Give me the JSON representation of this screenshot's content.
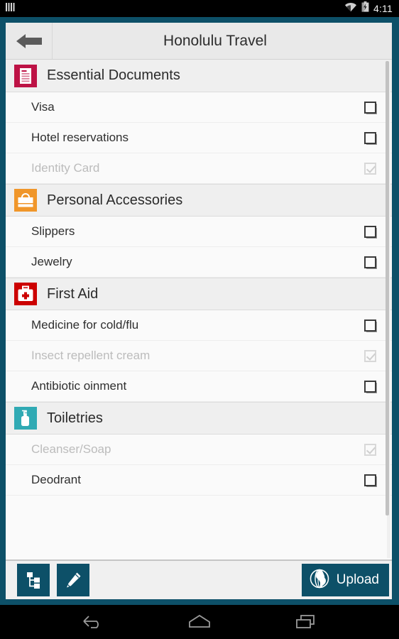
{
  "statusbar": {
    "time": "4:11",
    "icons": [
      "menu-bars-icon",
      "wifi-icon",
      "battery-icon"
    ]
  },
  "titlebar": {
    "back_label": "back-arrow-icon",
    "title": "Honolulu Travel"
  },
  "colors": {
    "frame_teal": "#0d5068",
    "documents_crimson": "#bd1245",
    "accessories_orange": "#f0962a",
    "firstaid_red": "#cc0000",
    "toiletries_teal": "#30aab4",
    "list_bg": "#fafafa",
    "header_bg": "#efefef"
  },
  "checklist": {
    "categories": [
      {
        "label": "Essential Documents",
        "icon": "document-icon",
        "icon_color": "#bd1245",
        "items": [
          {
            "label": "Visa",
            "checked": false
          },
          {
            "label": "Hotel reservations",
            "checked": false
          },
          {
            "label": "Identity Card",
            "checked": true
          }
        ]
      },
      {
        "label": "Personal Accessories",
        "icon": "handbag-icon",
        "icon_color": "#f0962a",
        "items": [
          {
            "label": "Slippers",
            "checked": false
          },
          {
            "label": "Jewelry",
            "checked": false
          }
        ]
      },
      {
        "label": "First Aid",
        "icon": "first-aid-kit-icon",
        "icon_color": "#cc0000",
        "items": [
          {
            "label": "Medicine for cold/flu",
            "checked": false
          },
          {
            "label": "Insect repellent cream",
            "checked": true
          },
          {
            "label": "Antibiotic oinment",
            "checked": false
          }
        ]
      },
      {
        "label": "Toiletries",
        "icon": "pump-bottle-icon",
        "icon_color": "#30aab4",
        "items": [
          {
            "label": "Cleanser/Soap",
            "checked": true
          },
          {
            "label": "Deodrant",
            "checked": false
          }
        ]
      }
    ]
  },
  "toolbar": {
    "buttons": [
      {
        "name": "hierarchy-button",
        "icon": "hierarchy-tree-icon"
      },
      {
        "name": "edit-button",
        "icon": "pencil-icon"
      }
    ],
    "upload_label": "Upload",
    "upload_icon": "globe-icon"
  },
  "navbar": {
    "buttons": [
      "back-nav-icon",
      "home-nav-icon",
      "recents-nav-icon"
    ]
  }
}
